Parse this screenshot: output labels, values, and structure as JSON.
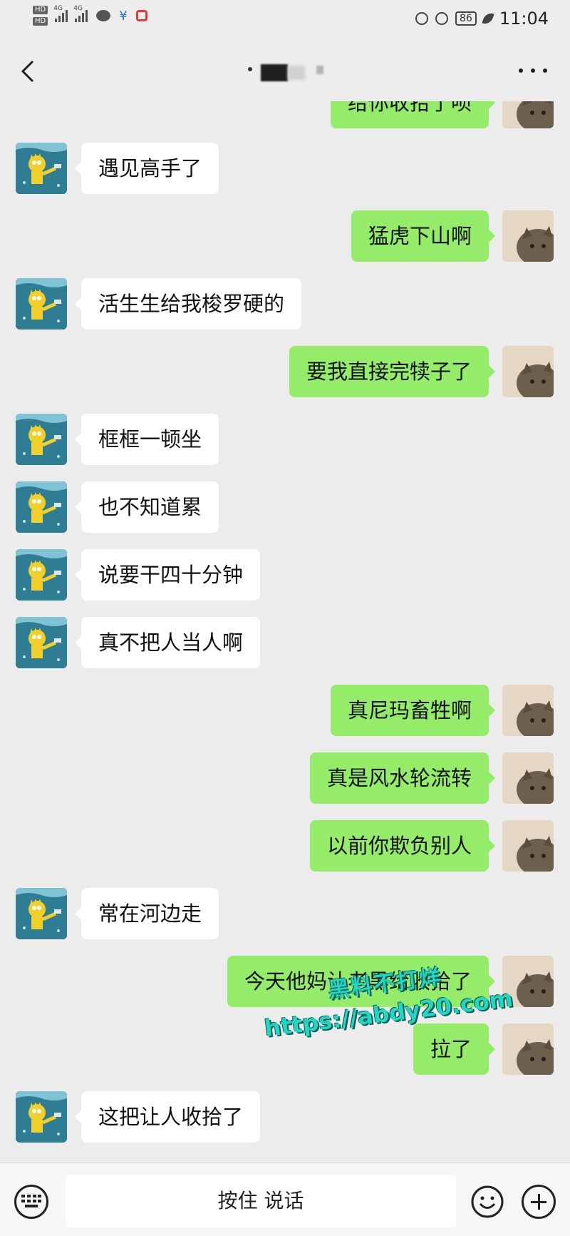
{
  "status_bar": {
    "hd1": "HD",
    "hd2": "HD",
    "network1": "4G",
    "network2": "4G",
    "battery": "86",
    "time": "11:04"
  },
  "nav": {
    "title": ""
  },
  "partial_top_message": "给你收拾了呗",
  "messages": [
    {
      "side": "left",
      "text": "遇见高手了"
    },
    {
      "side": "right",
      "text": "猛虎下山啊"
    },
    {
      "side": "left",
      "text": "活生生给我梭罗硬的"
    },
    {
      "side": "right",
      "text": "要我直接完犊子了"
    },
    {
      "side": "left",
      "text": "框框一顿坐"
    },
    {
      "side": "left",
      "text": "也不知道累"
    },
    {
      "side": "left",
      "text": "说要干四十分钟"
    },
    {
      "side": "left",
      "text": "真不把人当人啊"
    },
    {
      "side": "right",
      "text": "真尼玛畜牲啊"
    },
    {
      "side": "right",
      "text": "真是风水轮流转"
    },
    {
      "side": "right",
      "text": "以前你欺负别人"
    },
    {
      "side": "left",
      "text": "常在河边走"
    },
    {
      "side": "right",
      "text": "今天他妈让老黑给收拾了"
    },
    {
      "side": "right",
      "text": "拉了"
    },
    {
      "side": "left",
      "text": "这把让人收拾了"
    }
  ],
  "watermark": {
    "line1": "黑料不打烊",
    "line2": "https://abdy20.com"
  },
  "input_bar": {
    "voice_label": "按住 说话"
  },
  "colors": {
    "sent_bubble": "#95ec69",
    "received_bubble": "#ffffff",
    "background": "#ececec"
  }
}
